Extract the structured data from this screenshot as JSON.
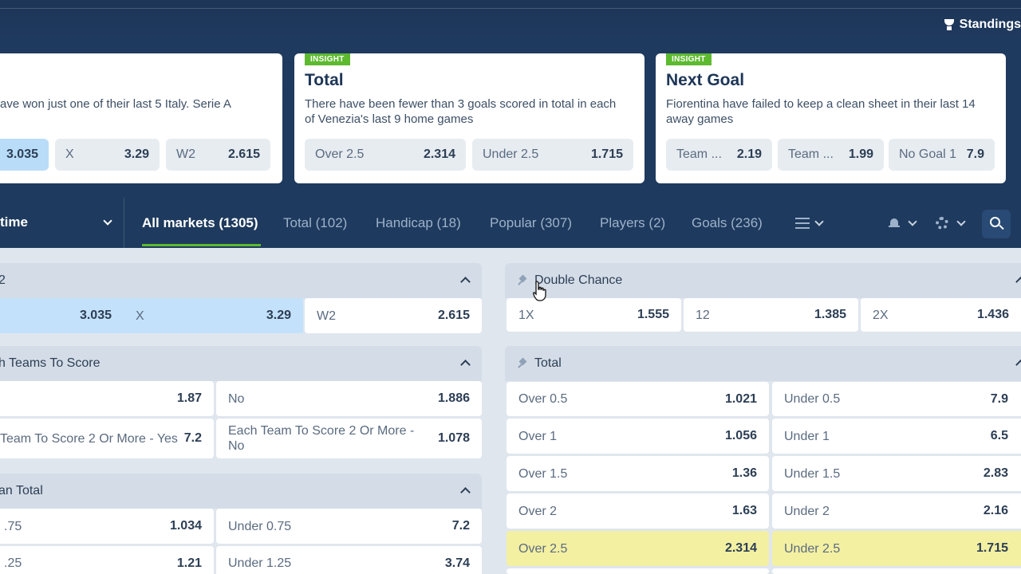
{
  "header": {
    "standings_label": "Standings"
  },
  "insights": [
    {
      "badge": "",
      "title": "",
      "desc": "ave won just one of their last 5 Italy. Serie A",
      "odds": [
        {
          "label": "",
          "value": "3.035"
        },
        {
          "label": "X",
          "value": "3.29"
        },
        {
          "label": "W2",
          "value": "2.615"
        }
      ]
    },
    {
      "badge": "INSIGHT",
      "title": "Total",
      "desc": "There have been fewer than 3 goals scored in total in each of Venezia's last 9 home games",
      "odds": [
        {
          "label": "Over 2.5",
          "value": "2.314"
        },
        {
          "label": "Under 2.5",
          "value": "1.715"
        }
      ]
    },
    {
      "badge": "INSIGHT",
      "title": "Next Goal",
      "desc": "Fiorentina have failed to keep a clean sheet in their last 14 away games",
      "odds": [
        {
          "label": "Team ...",
          "value": "2.19"
        },
        {
          "label": "Team ...",
          "value": "1.99"
        },
        {
          "label": "No Goal 1",
          "value": "7.9"
        }
      ]
    }
  ],
  "time_select": {
    "label": "time"
  },
  "tabs": [
    {
      "label": "All markets (1305)"
    },
    {
      "label": "Total (102)"
    },
    {
      "label": "Handicap (18)"
    },
    {
      "label": "Popular (307)"
    },
    {
      "label": "Players (2)"
    },
    {
      "label": "Goals (236)"
    }
  ],
  "icons": [
    "list-icon",
    "bell-icon",
    "gear-icon",
    "search-icon",
    "trophy-icon",
    "pin-icon",
    "chevron-up-icon"
  ],
  "markets": {
    "result": {
      "title": "2",
      "odds": [
        {
          "label": "",
          "value": "3.035"
        },
        {
          "label": "X",
          "value": "3.29"
        },
        {
          "label": "W2",
          "value": "2.615"
        }
      ]
    },
    "both_teams": {
      "title": "h Teams To Score",
      "rows": [
        [
          {
            "label": "",
            "value": "1.87"
          },
          {
            "label": "No",
            "value": "1.886"
          }
        ],
        [
          {
            "label": "Team To Score 2 Or More - Yes",
            "value": "7.2"
          },
          {
            "label": "Each Team To Score 2 Or More - No",
            "value": "1.078"
          }
        ]
      ]
    },
    "asian_total": {
      "title": "an Total",
      "rows": [
        [
          {
            "label": ".75",
            "value": "1.034"
          },
          {
            "label": "Under 0.75",
            "value": "7.2"
          }
        ],
        [
          {
            "label": ".25",
            "value": "1.21"
          },
          {
            "label": "Under 1.25",
            "value": "3.74"
          }
        ]
      ]
    },
    "double_chance": {
      "title": "Double Chance",
      "odds": [
        {
          "label": "1X",
          "value": "1.555"
        },
        {
          "label": "12",
          "value": "1.385"
        },
        {
          "label": "2X",
          "value": "1.436"
        }
      ]
    },
    "total": {
      "title": "Total",
      "rows": [
        [
          {
            "label": "Over 0.5",
            "value": "1.021"
          },
          {
            "label": "Under 0.5",
            "value": "7.9"
          }
        ],
        [
          {
            "label": "Over 1",
            "value": "1.056"
          },
          {
            "label": "Under 1",
            "value": "6.5"
          }
        ],
        [
          {
            "label": "Over 1.5",
            "value": "1.36"
          },
          {
            "label": "Under 1.5",
            "value": "2.83"
          }
        ],
        [
          {
            "label": "Over 2",
            "value": "1.63"
          },
          {
            "label": "Under 2",
            "value": "2.16"
          }
        ],
        [
          {
            "label": "Over 2.5",
            "value": "2.314"
          },
          {
            "label": "Under 2.5",
            "value": "1.715"
          }
        ]
      ]
    }
  },
  "colors": {
    "header_bg": "#1e3a5e",
    "insight_green": "#5dba2f",
    "selected_blue": "#b9dcf8",
    "highlight_yellow": "#f4f0a2"
  }
}
